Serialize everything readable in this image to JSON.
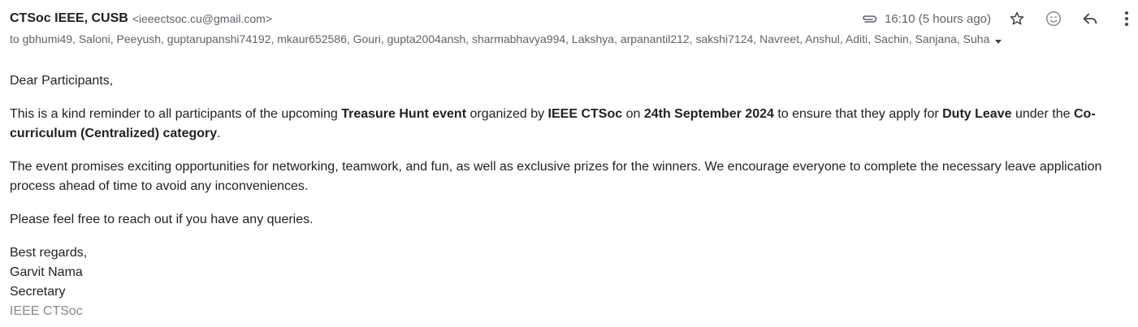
{
  "header": {
    "sender_name": "CTSoc IEEE, CUSB",
    "sender_email": "<ieeectsoc.cu@gmail.com>",
    "time": "16:10 (5 hours ago)",
    "icons": [
      "attachment-icon",
      "star-icon",
      "emoji-icon",
      "reply-icon",
      "more-vert-icon"
    ]
  },
  "recipients": "to gbhumi49, Saloni, Peeyush, guptarupanshi74192, mkaur652586, Gouri, gupta2004ansh, sharmabhavya994, Lakshya, arpanantil212, sakshi7124, Navreet, Anshul, Aditi, Sachin, Sanjana, Suha",
  "body": {
    "greeting": "Dear Participants,",
    "p1": {
      "t1": "This is a kind reminder to all participants of the upcoming ",
      "b1": "Treasure Hunt event",
      "t2": " organized by ",
      "b2": "IEEE CTSoc",
      "t3": " on ",
      "b3": "24th September 2024",
      "t4": " to ensure that they apply for ",
      "b4": "Duty Leave",
      "t5": " under the ",
      "b5": "Co-curriculum (Centralized) category",
      "t6": "."
    },
    "p2": "The event promises exciting opportunities for networking, teamwork, and fun, as well as exclusive prizes for the winners. We encourage everyone to complete the necessary leave application process ahead of time to avoid any inconveniences.",
    "p3": "Please feel free to reach out if you have any queries.",
    "signature": {
      "closing": "Best regards,",
      "name": "Garvit Nama",
      "title": "Secretary",
      "org": "IEEE CTSoc"
    }
  },
  "colors": {
    "text": "#222222",
    "muted": "#5f6368",
    "org": "#888888"
  }
}
